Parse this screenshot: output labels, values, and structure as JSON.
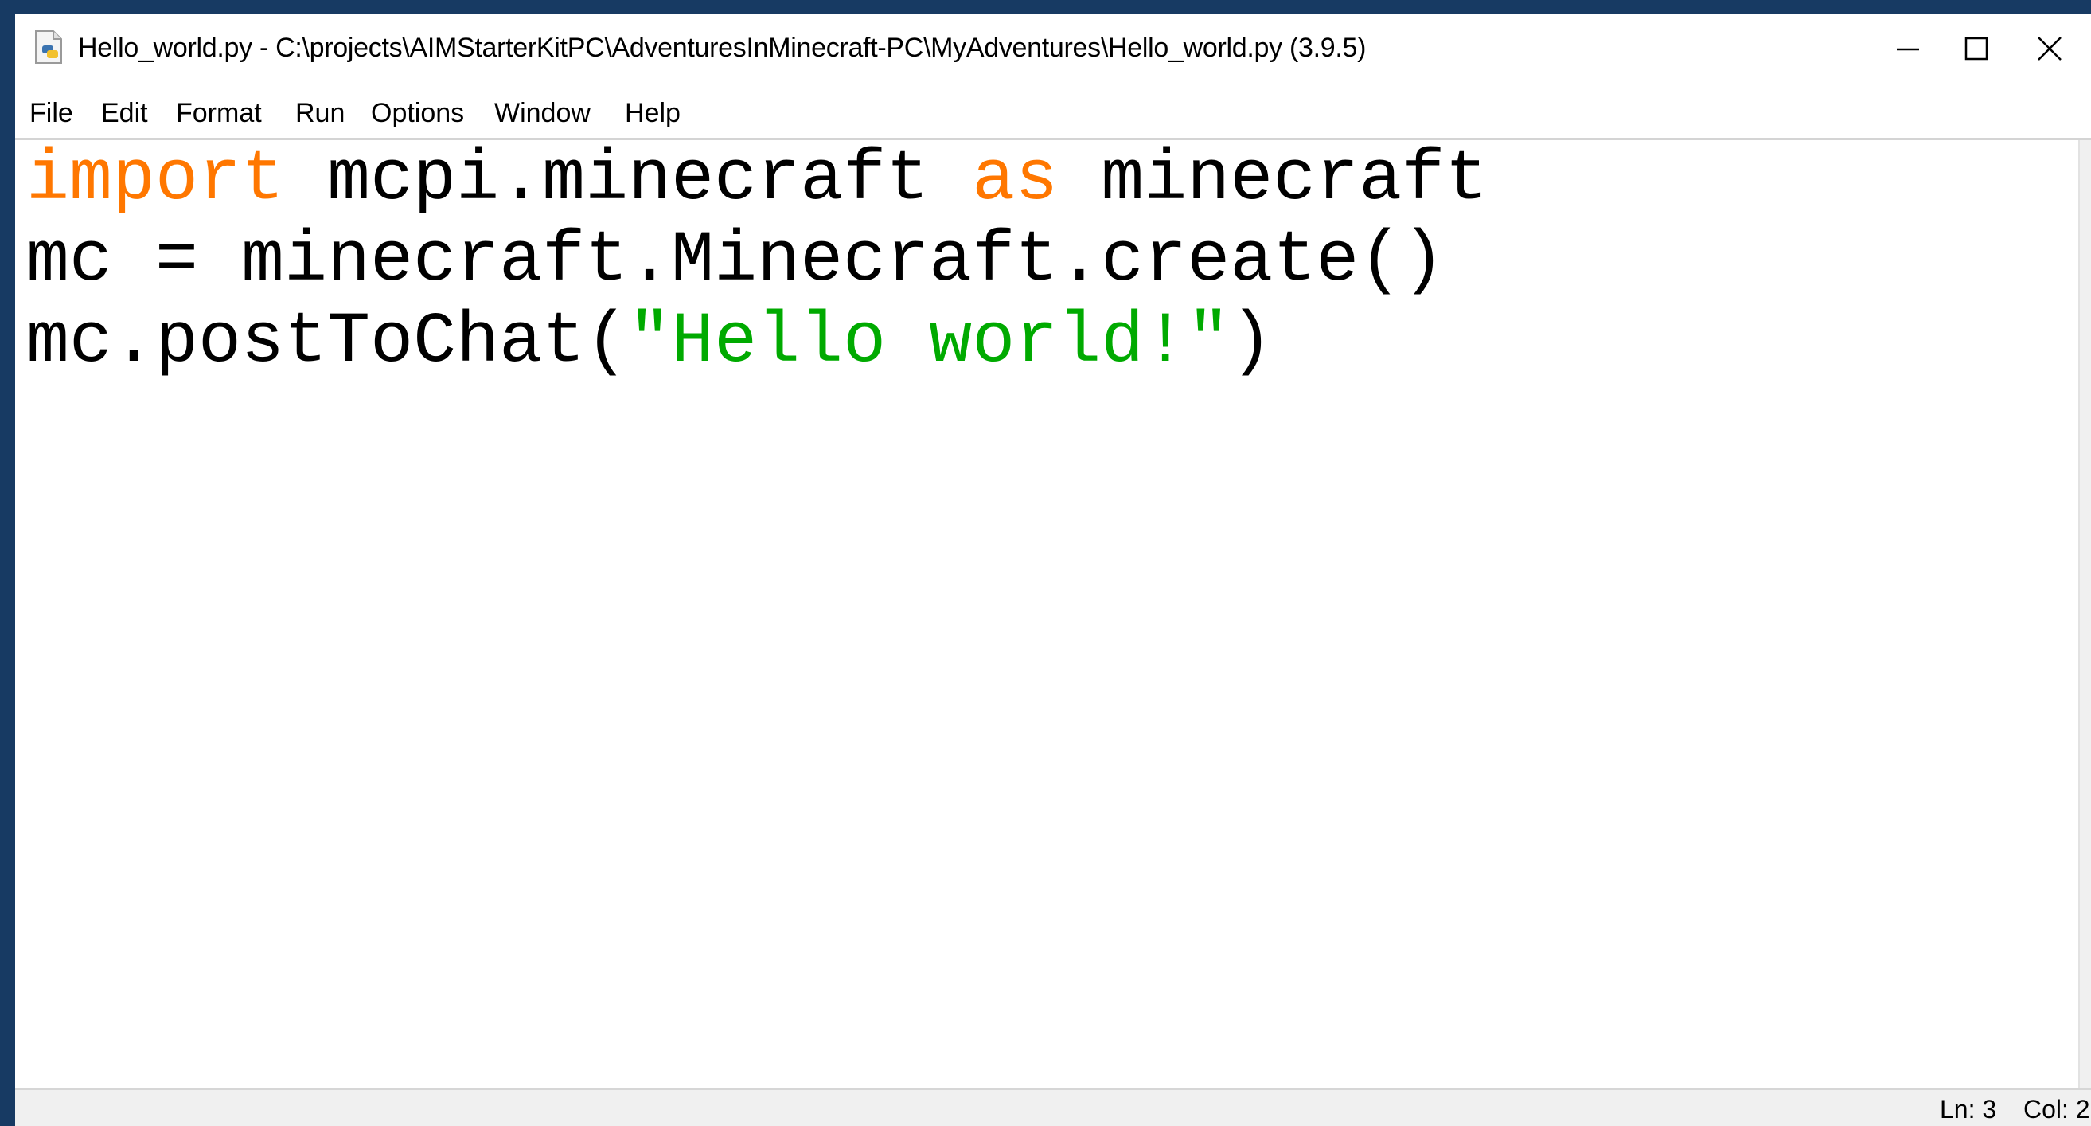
{
  "window": {
    "title": "Hello_world.py - C:\\projects\\AIMStarterKitPC\\AdventuresInMinecraft-PC\\MyAdventures\\Hello_world.py (3.9.5)",
    "icon": "python-file-icon",
    "controls": {
      "minimize_icon": "minimize-icon",
      "maximize_icon": "maximize-icon",
      "close_icon": "close-icon"
    }
  },
  "menu": {
    "file": "File",
    "edit": "Edit",
    "format": "Format",
    "run": "Run",
    "options": "Options",
    "window": "Window",
    "help": "Help"
  },
  "code": {
    "line1": {
      "kw_import": "import",
      "module": " mcpi.minecraft ",
      "kw_as": "as",
      "alias": " minecraft"
    },
    "line2": {
      "text": "mc = minecraft.Minecraft.create()"
    },
    "line3": {
      "prefix": "mc.postToChat(",
      "string": "\"Hello world!\"",
      "suffix": ")"
    }
  },
  "syntax_colors": {
    "keyword": "#ff7700",
    "string": "#00aa00",
    "default": "#000000"
  },
  "status": {
    "line": "Ln: 3",
    "col": "Col: 2"
  }
}
